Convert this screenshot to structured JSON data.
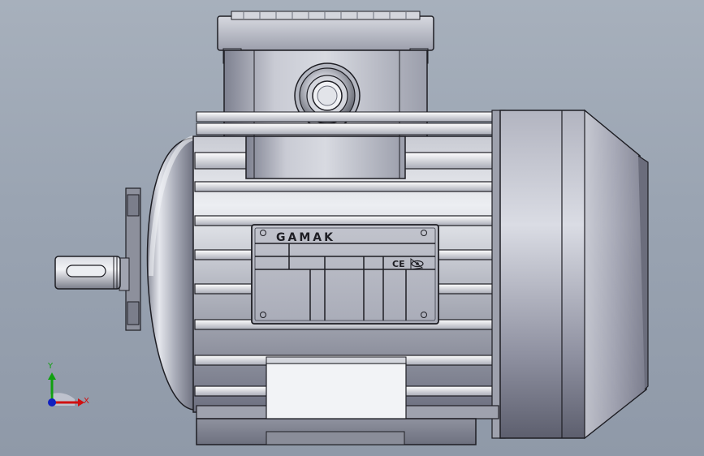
{
  "viewport": {
    "background_color": "#9aa4b2"
  },
  "model": {
    "name": "electric-motor",
    "nameplate": {
      "brand": "GAMAK",
      "ce_mark": "CE",
      "certification_icon": "eye-in-triangle-icon"
    },
    "colors": {
      "metal_light": "#e8eaf0",
      "metal_mid": "#b9bcc6",
      "metal_dark": "#5a5d6a",
      "outline": "#1e1e24"
    }
  },
  "triad": {
    "x_label": "X",
    "y_label": "Y",
    "x_color": "#d01010",
    "y_color": "#10a010",
    "z_color": "#1020c0"
  }
}
